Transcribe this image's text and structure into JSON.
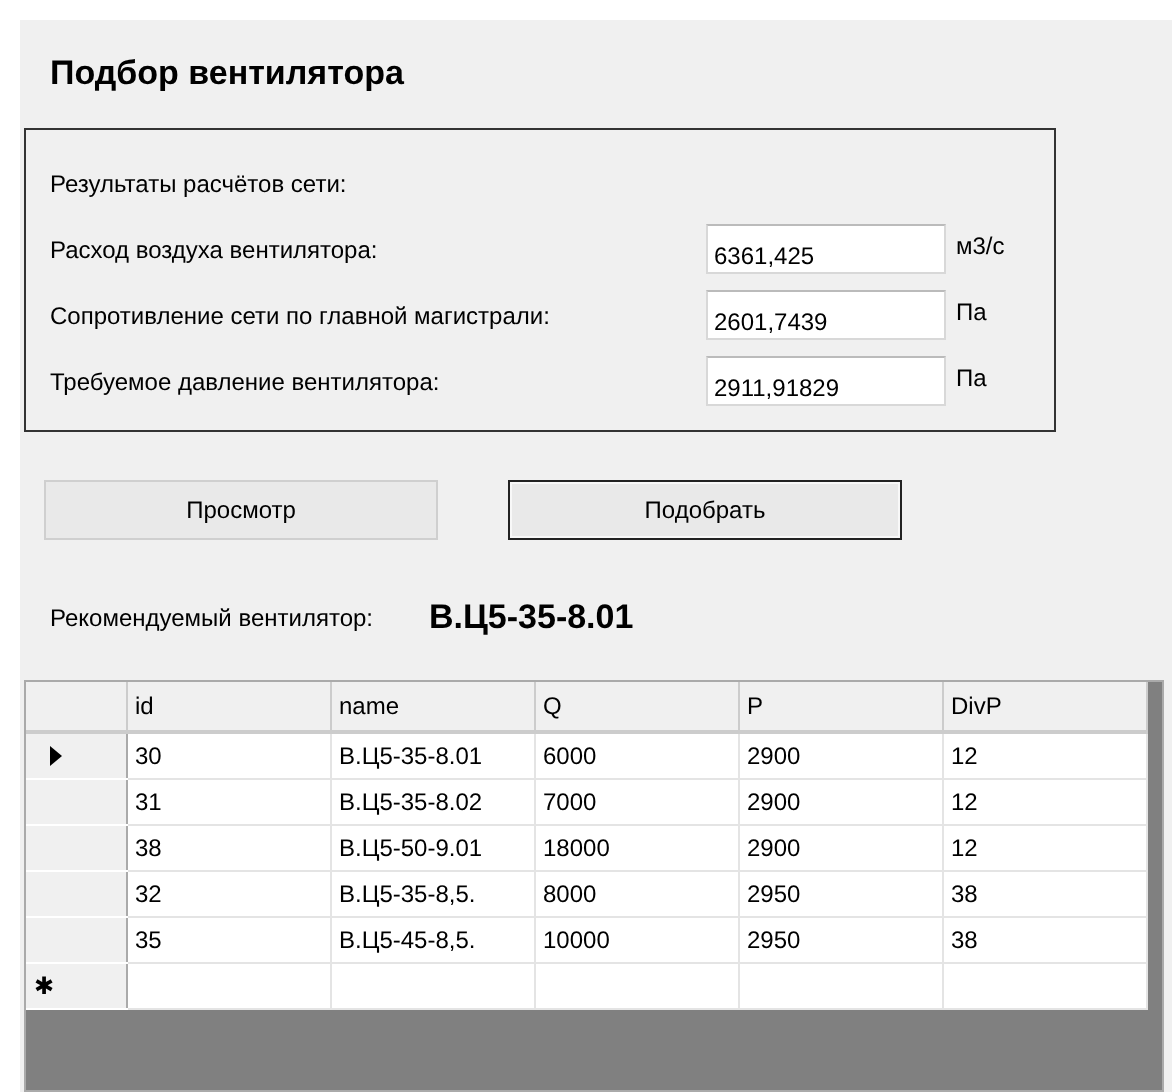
{
  "title": "Подбор вентилятора",
  "results": {
    "caption": "Результаты расчётов сети:",
    "fields": [
      {
        "label": "Расход воздуха вентилятора:",
        "value": "6361,425",
        "unit": "м3/с"
      },
      {
        "label": "Сопротивление сети по главной магистрали:",
        "value": "2601,7439",
        "unit": "Па"
      },
      {
        "label": "Требуемое давление вентилятора:",
        "value": "2911,91829",
        "unit": "Па"
      }
    ]
  },
  "buttons": [
    {
      "label": "Просмотр",
      "default": false
    },
    {
      "label": "Подобрать",
      "default": true
    }
  ],
  "recommended": {
    "label": "Рекомендуемый вентилятор:",
    "value": "В.Ц5-35-8.01"
  },
  "table": {
    "columns": [
      "id",
      "name",
      "Q",
      "P",
      "DivP"
    ],
    "rows": [
      {
        "cells": [
          "30",
          "В.Ц5-35-8.01",
          "6000",
          "2900",
          "12"
        ],
        "selected": true
      },
      {
        "cells": [
          "31",
          "В.Ц5-35-8.02",
          "7000",
          "2900",
          "12"
        ],
        "selected": false
      },
      {
        "cells": [
          "38",
          "В.Ц5-50-9.01",
          "18000",
          "2900",
          "12"
        ],
        "selected": false
      },
      {
        "cells": [
          "32",
          "В.Ц5-35-8,5.",
          "8000",
          "2950",
          "38"
        ],
        "selected": false
      },
      {
        "cells": [
          "35",
          "В.Ц5-45-8,5.",
          "10000",
          "2950",
          "38"
        ],
        "selected": false
      }
    ],
    "new_row_marker": "✱"
  }
}
